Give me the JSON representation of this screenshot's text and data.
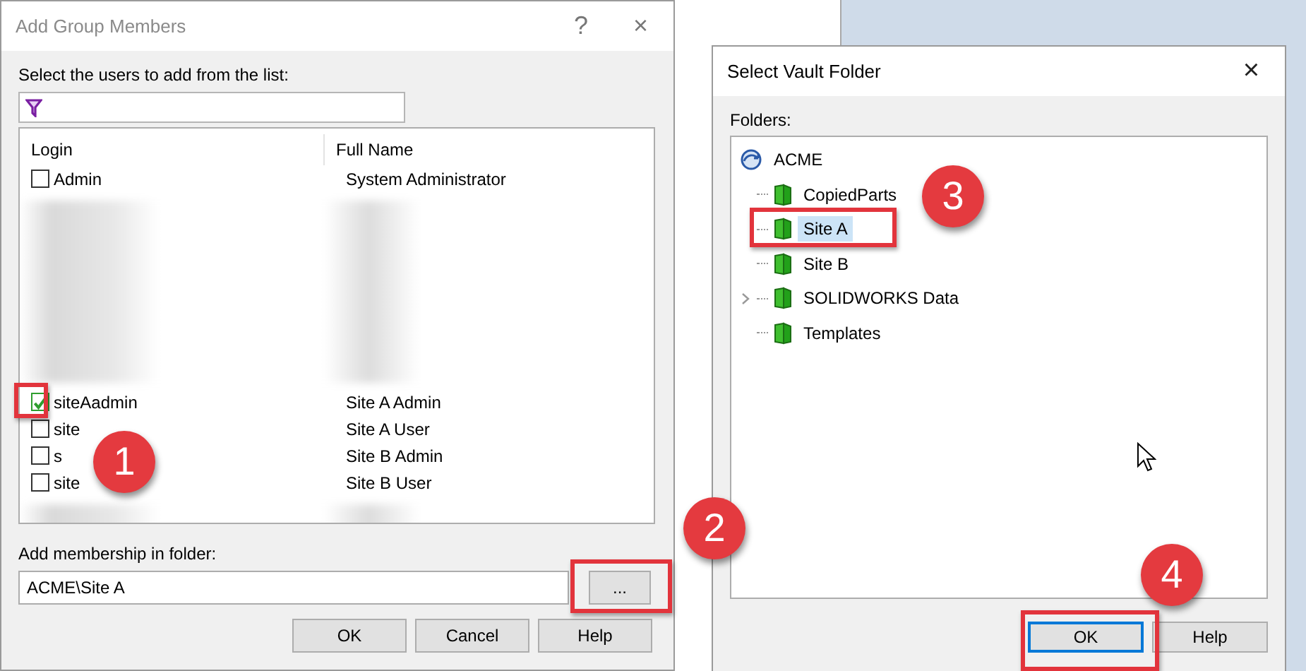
{
  "add_dialog": {
    "title": "Add Group Members",
    "help_glyph": "?",
    "close_glyph": "×",
    "prompt": "Select the users to add from the list:",
    "columns": [
      "Login",
      "Full Name"
    ],
    "rows": [
      {
        "login": "Admin",
        "full_name": "System Administrator",
        "checked": false
      },
      {
        "login": "siteAadmin",
        "full_name": "Site A Admin",
        "checked": true
      },
      {
        "login": "site",
        "full_name": "Site A User",
        "checked": false
      },
      {
        "login": "s",
        "full_name": "Site B Admin",
        "checked": false
      },
      {
        "login": "site",
        "full_name": "Site B User",
        "checked": false
      }
    ],
    "folder_label": "Add membership in folder:",
    "folder_value": "ACME\\Site A",
    "browse_label": "...",
    "buttons": [
      "OK",
      "Cancel",
      "Help"
    ]
  },
  "vault_dialog": {
    "title": "Select Vault Folder",
    "close_glyph": "×",
    "folders_label": "Folders:",
    "tree": {
      "label": "ACME",
      "selected": false,
      "children": [
        {
          "label": "CopiedParts",
          "selected": false,
          "expandable": false
        },
        {
          "label": "Site A",
          "selected": true,
          "expandable": false
        },
        {
          "label": "Site B",
          "selected": false,
          "expandable": false
        },
        {
          "label": "SOLIDWORKS Data",
          "selected": false,
          "expandable": true
        },
        {
          "label": "Templates",
          "selected": false,
          "expandable": false
        }
      ]
    },
    "buttons": [
      {
        "label": "OK",
        "focused": true
      },
      {
        "label": "Help",
        "focused": false
      }
    ]
  },
  "annotations": [
    "1",
    "2",
    "3",
    "4"
  ]
}
